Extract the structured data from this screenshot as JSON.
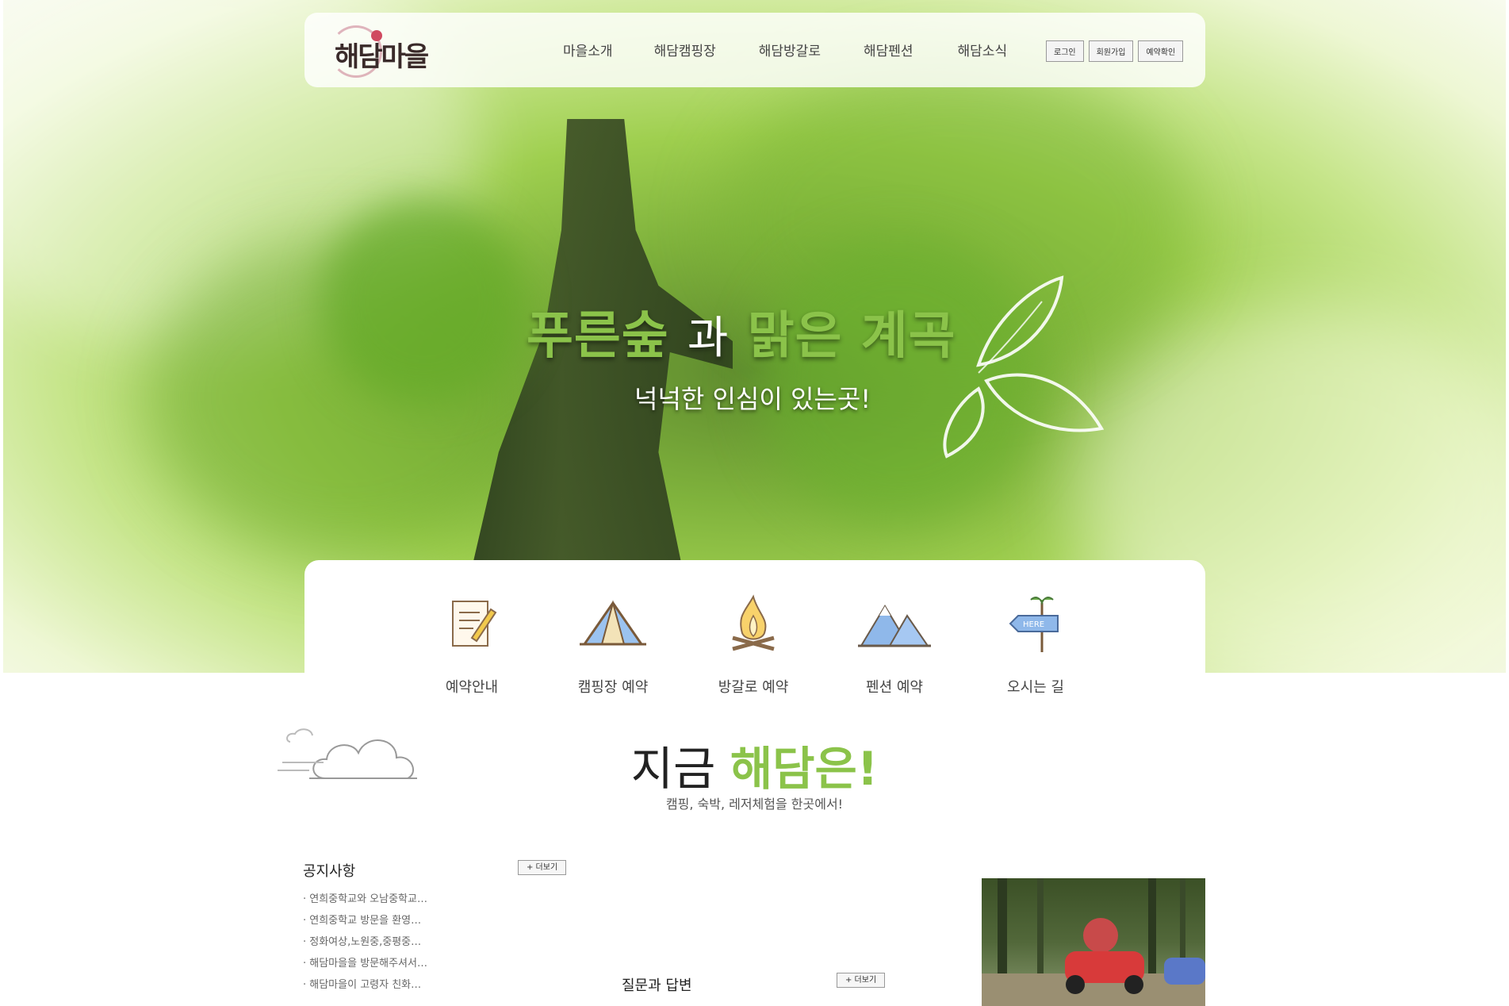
{
  "nav": {
    "logo_text": "해담마을",
    "menu": [
      {
        "label": "마을소개"
      },
      {
        "label": "해담캠핑장"
      },
      {
        "label": "해담방갈로"
      },
      {
        "label": "해담펜션"
      },
      {
        "label": "해담소식"
      }
    ],
    "utils": {
      "login": "로그인",
      "signup": "회원가입",
      "reservation_check": "예약확인"
    }
  },
  "hero": {
    "headline_a": "푸른숲",
    "headline_b": "과",
    "headline_c": "맑은 계곡",
    "subline": "넉넉한 인심이 있는곳!"
  },
  "quick": [
    {
      "label": "예약안내",
      "icon": "document-pen-icon"
    },
    {
      "label": "캠핑장 예약",
      "icon": "tent-icon"
    },
    {
      "label": "방갈로 예약",
      "icon": "campfire-icon"
    },
    {
      "label": "펜션 예약",
      "icon": "mountain-icon"
    },
    {
      "label": "오시는 길",
      "icon": "signpost-icon"
    }
  ],
  "section": {
    "title_a": "지금",
    "title_b": "해담은!",
    "subtitle": "캠핑, 숙박, 레저체험을 한곳에서!"
  },
  "notice": {
    "heading": "공지사항",
    "more": "+ 더보기",
    "items": [
      "연희중학교와 오남중학교…",
      "연희중학교 방문을 환영…",
      "정화여상,노원중,중평중…",
      "해담마을을 방문해주셔서…",
      "해담마을이 고령자 친화…"
    ]
  },
  "qa": {
    "heading": "질문과 답변",
    "more": "+ 더보기"
  },
  "colors": {
    "accent": "#8bc34a"
  }
}
